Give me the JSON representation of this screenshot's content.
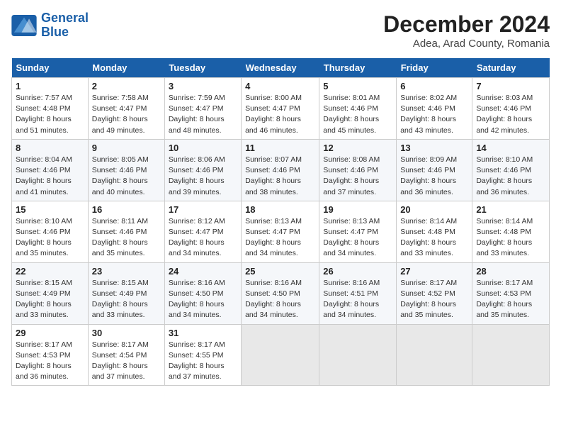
{
  "logo": {
    "line1": "General",
    "line2": "Blue"
  },
  "title": "December 2024",
  "location": "Adea, Arad County, Romania",
  "weekdays": [
    "Sunday",
    "Monday",
    "Tuesday",
    "Wednesday",
    "Thursday",
    "Friday",
    "Saturday"
  ],
  "weeks": [
    [
      {
        "day": "1",
        "sunrise": "7:57 AM",
        "sunset": "4:48 PM",
        "daylight": "8 hours and 51 minutes."
      },
      {
        "day": "2",
        "sunrise": "7:58 AM",
        "sunset": "4:47 PM",
        "daylight": "8 hours and 49 minutes."
      },
      {
        "day": "3",
        "sunrise": "7:59 AM",
        "sunset": "4:47 PM",
        "daylight": "8 hours and 48 minutes."
      },
      {
        "day": "4",
        "sunrise": "8:00 AM",
        "sunset": "4:47 PM",
        "daylight": "8 hours and 46 minutes."
      },
      {
        "day": "5",
        "sunrise": "8:01 AM",
        "sunset": "4:46 PM",
        "daylight": "8 hours and 45 minutes."
      },
      {
        "day": "6",
        "sunrise": "8:02 AM",
        "sunset": "4:46 PM",
        "daylight": "8 hours and 43 minutes."
      },
      {
        "day": "7",
        "sunrise": "8:03 AM",
        "sunset": "4:46 PM",
        "daylight": "8 hours and 42 minutes."
      }
    ],
    [
      {
        "day": "8",
        "sunrise": "8:04 AM",
        "sunset": "4:46 PM",
        "daylight": "8 hours and 41 minutes."
      },
      {
        "day": "9",
        "sunrise": "8:05 AM",
        "sunset": "4:46 PM",
        "daylight": "8 hours and 40 minutes."
      },
      {
        "day": "10",
        "sunrise": "8:06 AM",
        "sunset": "4:46 PM",
        "daylight": "8 hours and 39 minutes."
      },
      {
        "day": "11",
        "sunrise": "8:07 AM",
        "sunset": "4:46 PM",
        "daylight": "8 hours and 38 minutes."
      },
      {
        "day": "12",
        "sunrise": "8:08 AM",
        "sunset": "4:46 PM",
        "daylight": "8 hours and 37 minutes."
      },
      {
        "day": "13",
        "sunrise": "8:09 AM",
        "sunset": "4:46 PM",
        "daylight": "8 hours and 36 minutes."
      },
      {
        "day": "14",
        "sunrise": "8:10 AM",
        "sunset": "4:46 PM",
        "daylight": "8 hours and 36 minutes."
      }
    ],
    [
      {
        "day": "15",
        "sunrise": "8:10 AM",
        "sunset": "4:46 PM",
        "daylight": "8 hours and 35 minutes."
      },
      {
        "day": "16",
        "sunrise": "8:11 AM",
        "sunset": "4:46 PM",
        "daylight": "8 hours and 35 minutes."
      },
      {
        "day": "17",
        "sunrise": "8:12 AM",
        "sunset": "4:47 PM",
        "daylight": "8 hours and 34 minutes."
      },
      {
        "day": "18",
        "sunrise": "8:13 AM",
        "sunset": "4:47 PM",
        "daylight": "8 hours and 34 minutes."
      },
      {
        "day": "19",
        "sunrise": "8:13 AM",
        "sunset": "4:47 PM",
        "daylight": "8 hours and 34 minutes."
      },
      {
        "day": "20",
        "sunrise": "8:14 AM",
        "sunset": "4:48 PM",
        "daylight": "8 hours and 33 minutes."
      },
      {
        "day": "21",
        "sunrise": "8:14 AM",
        "sunset": "4:48 PM",
        "daylight": "8 hours and 33 minutes."
      }
    ],
    [
      {
        "day": "22",
        "sunrise": "8:15 AM",
        "sunset": "4:49 PM",
        "daylight": "8 hours and 33 minutes."
      },
      {
        "day": "23",
        "sunrise": "8:15 AM",
        "sunset": "4:49 PM",
        "daylight": "8 hours and 33 minutes."
      },
      {
        "day": "24",
        "sunrise": "8:16 AM",
        "sunset": "4:50 PM",
        "daylight": "8 hours and 34 minutes."
      },
      {
        "day": "25",
        "sunrise": "8:16 AM",
        "sunset": "4:50 PM",
        "daylight": "8 hours and 34 minutes."
      },
      {
        "day": "26",
        "sunrise": "8:16 AM",
        "sunset": "4:51 PM",
        "daylight": "8 hours and 34 minutes."
      },
      {
        "day": "27",
        "sunrise": "8:17 AM",
        "sunset": "4:52 PM",
        "daylight": "8 hours and 35 minutes."
      },
      {
        "day": "28",
        "sunrise": "8:17 AM",
        "sunset": "4:53 PM",
        "daylight": "8 hours and 35 minutes."
      }
    ],
    [
      {
        "day": "29",
        "sunrise": "8:17 AM",
        "sunset": "4:53 PM",
        "daylight": "8 hours and 36 minutes."
      },
      {
        "day": "30",
        "sunrise": "8:17 AM",
        "sunset": "4:54 PM",
        "daylight": "8 hours and 37 minutes."
      },
      {
        "day": "31",
        "sunrise": "8:17 AM",
        "sunset": "4:55 PM",
        "daylight": "8 hours and 37 minutes."
      },
      null,
      null,
      null,
      null
    ]
  ]
}
